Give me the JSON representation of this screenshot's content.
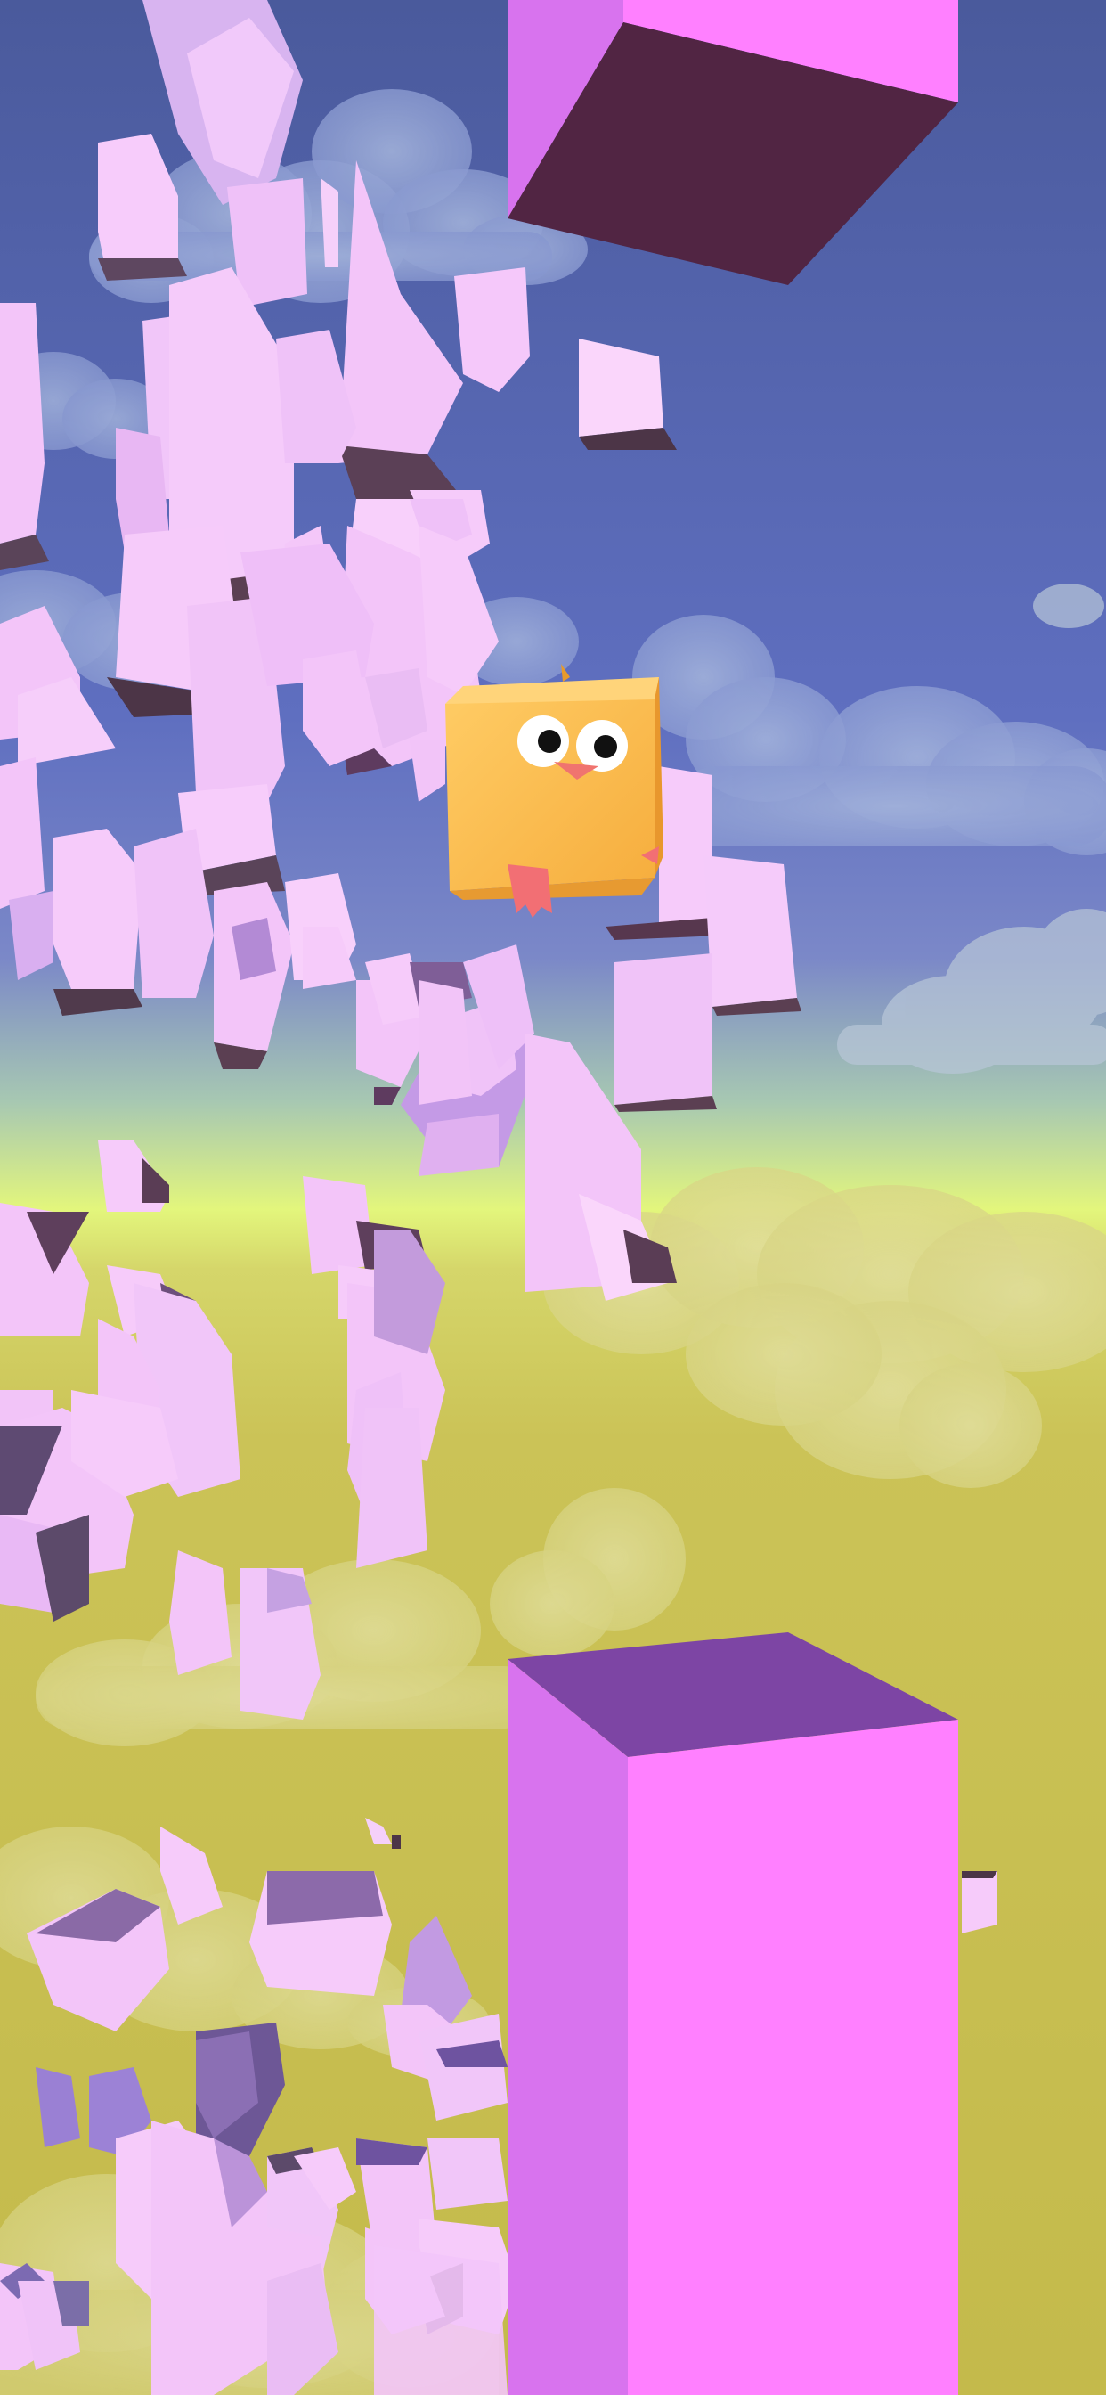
{
  "game": {
    "name": "",
    "state": "playing",
    "score": null,
    "player": {
      "character": "yellow-cube-bird",
      "eye_count": 2,
      "has_beak": true,
      "has_feet": true
    },
    "obstacles": [
      {
        "type": "pillar",
        "position": "top"
      },
      {
        "type": "pillar",
        "position": "bottom"
      }
    ],
    "effects": [
      "shattered-crystal-fragments"
    ]
  },
  "colors": {
    "sky_top": "#4a5aa0",
    "sky_mid": "#6d7cc7",
    "horizon": "#e2f57b",
    "ground": "#c8bf4e",
    "pillar_front": "#ff80ff",
    "pillar_side": "#d873ee",
    "pillar_top": "#7d45a4",
    "pillar_underside": "#512543",
    "crystal_light": "#f7c7f9",
    "crystal_mid": "#e5b0f1",
    "crystal_dark": "#5c4a7a",
    "bird_body": "#ffc155",
    "bird_shade": "#f3a83a",
    "bird_feet": "#f26f74"
  },
  "icons": {
    "player": "bird-cube-icon"
  }
}
